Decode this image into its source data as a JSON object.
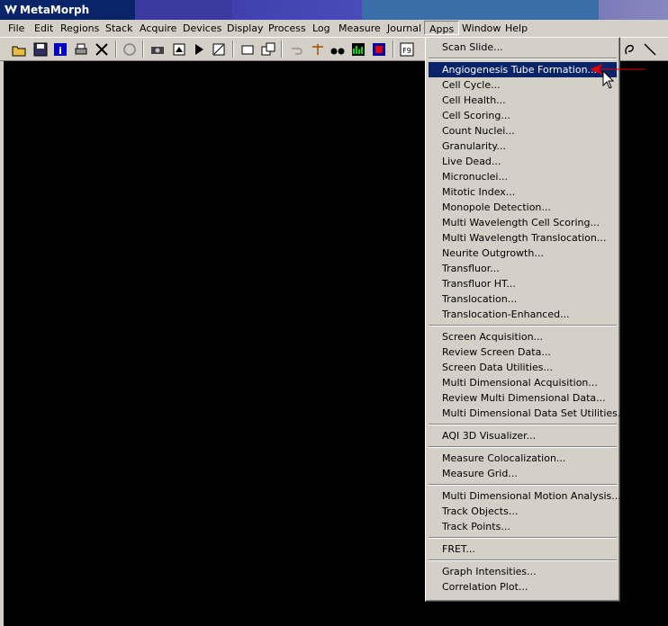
{
  "window": {
    "title": "MetaMorph"
  },
  "menubar": {
    "items": [
      "File",
      "Edit",
      "Regions",
      "Stack",
      "Acquire",
      "Devices",
      "Display",
      "Process",
      "Log",
      "Measure",
      "Journal",
      "Apps",
      "Window",
      "Help"
    ]
  },
  "toolbar": {
    "icons": [
      "open-folder-icon",
      "save-icon",
      "info-icon",
      "print-icon",
      "close-x-icon",
      "reset-icon",
      "camera-icon",
      "acquire-icon",
      "stream-icon",
      "image-settings-icon",
      "region-tool-icon",
      "region-copy-icon",
      "undo-icon",
      "scale-icon",
      "binoculars-icon",
      "histogram-icon",
      "palette-icon",
      "f9-icon",
      "lasso-icon",
      "line-icon"
    ]
  },
  "apps_menu": {
    "groups": [
      [
        "Scan Slide..."
      ],
      [
        "Angiogenesis Tube Formation...",
        "Cell Cycle...",
        "Cell Health...",
        "Cell Scoring...",
        "Count Nuclei...",
        "Granularity...",
        "Live Dead...",
        "Micronuclei...",
        "Mitotic Index...",
        "Monopole Detection...",
        "Multi Wavelength Cell Scoring...",
        "Multi Wavelength Translocation...",
        "Neurite Outgrowth...",
        "Transfluor...",
        "Transfluor HT...",
        "Translocation...",
        "Translocation-Enhanced..."
      ],
      [
        "Screen Acquisition...",
        "Review Screen Data...",
        "Screen Data Utilities...",
        "Multi Dimensional Acquisition...",
        "Review Multi Dimensional Data...",
        "Multi Dimensional Data Set Utilities..."
      ],
      [
        "AQI 3D Visualizer..."
      ],
      [
        "Measure Colocalization...",
        "Measure Grid..."
      ],
      [
        "Multi Dimensional Motion Analysis...",
        "Track Objects...",
        "Track Points..."
      ],
      [
        "FRET..."
      ],
      [
        "Graph Intensities...",
        "Correlation Plot..."
      ]
    ],
    "highlighted": "Angiogenesis Tube Formation..."
  },
  "colors": {
    "highlight": "#0a246a",
    "annotation_arrow": "#e00000"
  }
}
